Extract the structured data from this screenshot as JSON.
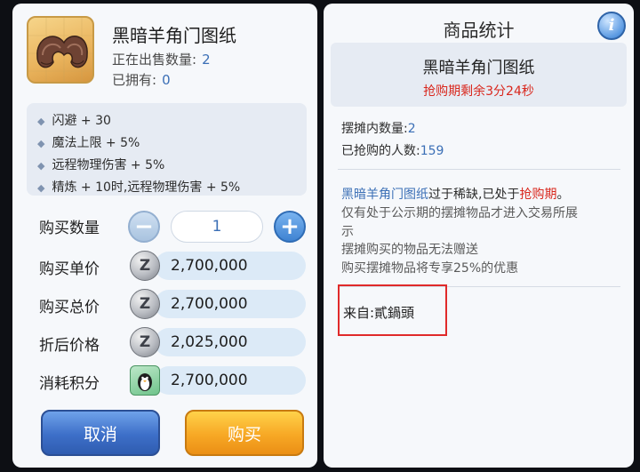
{
  "left": {
    "item_name": "黑暗羊角门图纸",
    "on_sale_label": "正在出售数量:",
    "on_sale_value": "2",
    "owned_label": "已拥有:",
    "owned_value": "0",
    "attributes": [
      "闪避 + 30",
      "魔法上限 + 5%",
      "远程物理伤害 + 5%",
      "精炼 + 10时,远程物理伤害 + 5%"
    ],
    "quantity_label": "购买数量",
    "quantity_value": "1",
    "unit_price_label": "购买单价",
    "unit_price_value": "2,700,000",
    "total_price_label": "购买总价",
    "total_price_value": "2,700,000",
    "discount_price_label": "折后价格",
    "discount_price_value": "2,025,000",
    "points_label": "消耗积分",
    "points_value": "2,700,000",
    "cancel_label": "取消",
    "buy_label": "购买",
    "coin_glyph": "Z",
    "minus_glyph": "−",
    "plus_glyph": "+"
  },
  "right": {
    "title": "商品统计",
    "info_glyph": "i",
    "item_name": "黑暗羊角门图纸",
    "countdown": "抢购期剩余3分24秒",
    "stall_count_label": "摆摊内数量:",
    "stall_count_value": "2",
    "buyers_label": "已抢购的人数:",
    "buyers_value": "159",
    "notice_item": "黑暗羊角门图纸",
    "notice_mid": "过于稀缺,已处于",
    "notice_phase": "抢购期",
    "notice_end": "。",
    "notice_line2": "仅有处于公示期的摆摊物品才进入交易所展",
    "notice_line3": "示",
    "notice_line4": "摆摊购买的物品无法赠送",
    "notice_line5": "购买摆摊物品将专享25%的优惠",
    "source": "来自:貳鍋頭"
  },
  "colors": {
    "accent_blue": "#3b6fb6",
    "alert_red": "#d9271d",
    "cancel_button": "#3d6fc8",
    "buy_button": "#f7a825"
  }
}
